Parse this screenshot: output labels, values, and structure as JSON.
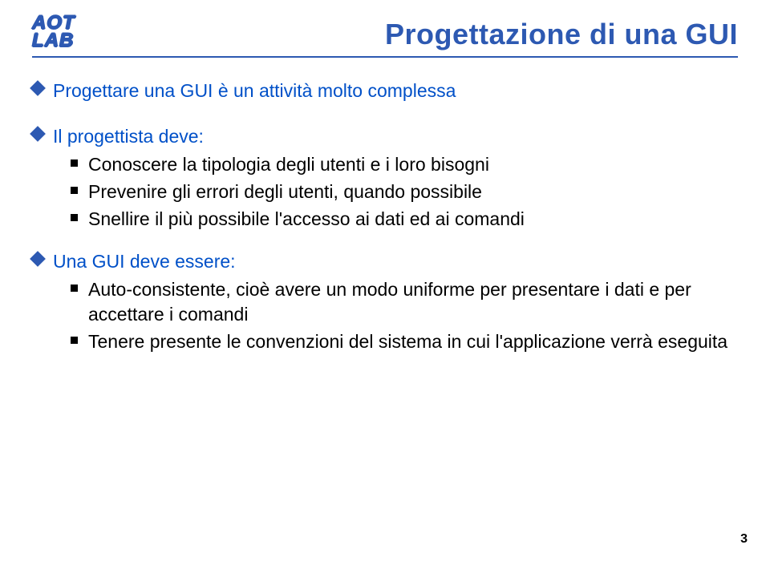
{
  "logo": {
    "line1": "AOT",
    "line2": "LAB"
  },
  "title": "Progettazione di una GUI",
  "main_point_1": "Progettare una GUI è un attività molto complessa",
  "main_point_2": "Il progettista deve:",
  "sub_list_1": {
    "i0": "Conoscere la tipologia degli utenti e i loro bisogni",
    "i1": "Prevenire gli errori degli utenti, quando possibile",
    "i2": "Snellire il più possibile l'accesso ai dati ed ai comandi"
  },
  "main_point_3": "Una GUI deve essere:",
  "sub_list_2": {
    "i0": "Auto-consistente, cioè avere un modo uniforme per presentare i dati e per accettare i comandi",
    "i1": "Tenere presente le convenzioni del sistema in cui l'applicazione verrà eseguita"
  },
  "page_number": "3"
}
